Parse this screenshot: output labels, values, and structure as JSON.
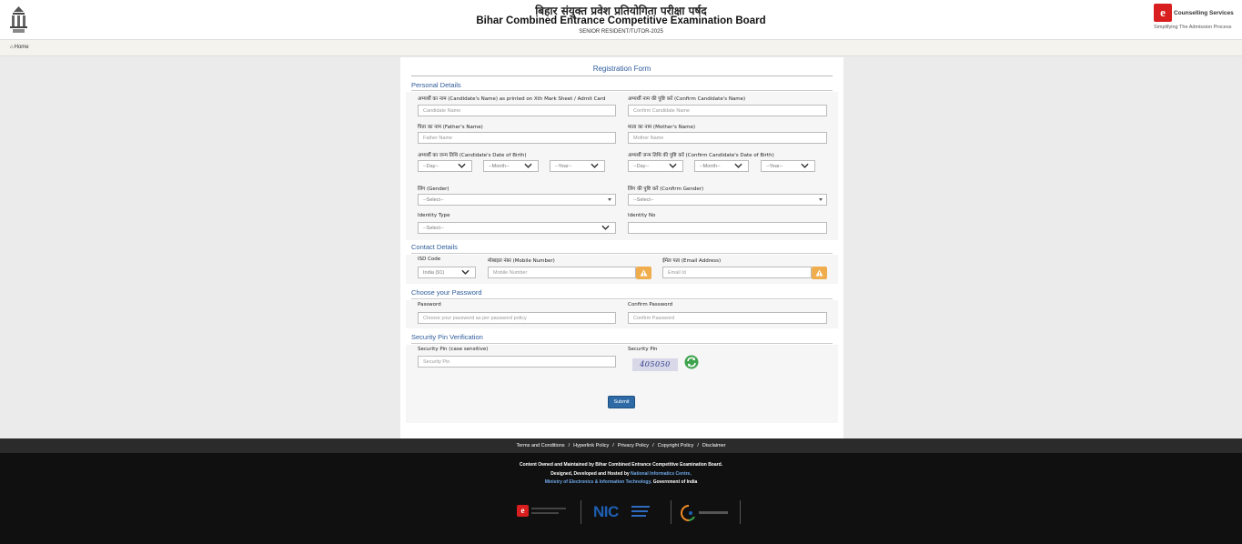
{
  "header": {
    "hindi_title": "बिहार संयुक्त प्रवेश प्रतियोगिता परीक्षा पर्षद",
    "title": "Bihar Combined Entrance Competitive Examination Board",
    "subtitle": "SENIOR RESIDENT/TUTOR-2025",
    "brand_name": "Counselling Services",
    "brand_tagline": "Simplifying The Admission Process"
  },
  "breadcrumb": {
    "home": "Home"
  },
  "form": {
    "title": "Registration Form",
    "personal": {
      "section_title": "Personal Details",
      "candidate_name_label": "अभ्यर्थी का नाम (Candidate's Name) as printed on Xth Mark Sheet / Admit Card",
      "candidate_name_placeholder": "Candidate Name",
      "confirm_name_label": "अभ्यर्थी नाम की पुष्टि करें (Confirm Candidate's Name)",
      "confirm_name_placeholder": "Confirm Candidate Name",
      "father_label": "पिता का नाम (Father's Name)",
      "father_placeholder": "Father Name",
      "mother_label": "माता का नाम (Mother's Name)",
      "mother_placeholder": "Mother Name",
      "dob_label": "अभ्यर्थी का जन्म तिथि (Candidate's Date of Birth)",
      "confirm_dob_label": "अभ्यर्थी जन्म तिथि की पुष्टि करें (Confirm Candidate's Date of Birth)",
      "day": "--Day--",
      "month": "--Month--",
      "year": "--Year--",
      "gender_label": "लिंग (Gender)",
      "confirm_gender_label": "लिंग की पुष्टि करें (Confirm Gender)",
      "select": "--Select--",
      "identity_type_label": "Identity Type",
      "identity_no_label": "Identity No"
    },
    "contact": {
      "section_title": "Contact Details",
      "isd_label": "ISD Code",
      "isd_value": "India (91)",
      "mobile_label": "मोबाइल नंबर (Mobile Number)",
      "mobile_placeholder": "Mobile Number",
      "email_label": "ईमेल पता (Email Address)",
      "email_placeholder": "Email Id"
    },
    "password": {
      "section_title": "Choose your Password",
      "password_label": "Password",
      "password_placeholder": "Choose your password as per password policy",
      "confirm_label": "Confirm Password",
      "confirm_placeholder": "Confirm Password"
    },
    "security": {
      "section_title": "Security Pin Verification",
      "pin_label": "Security Pin (case sensitive)",
      "pin_placeholder": "Security Pin",
      "captcha_label": "Security Pin",
      "captcha_value": "405050"
    },
    "submit": "Submit"
  },
  "footer": {
    "links": [
      "Terms and Conditions",
      "Hyperlink Policy",
      "Privacy Policy",
      "Copyright Policy",
      "Disclaimer"
    ],
    "line1": "Content Owned and Maintained by Bihar Combined Entrance Competitive Examination Board.",
    "line2_prefix": "Designed, Developed and Hosted by",
    "line2_link": "National Informatics Centre,",
    "line3_link": "Ministry of Electronics & Information Technology,",
    "line3_suffix": "Government of India",
    "nic_text": "NIC"
  },
  "colors": {
    "accent": "#2e5c9b",
    "warn": "#f0ad4e",
    "submit": "#2e6ba6",
    "brand_red": "#d81e1e"
  }
}
